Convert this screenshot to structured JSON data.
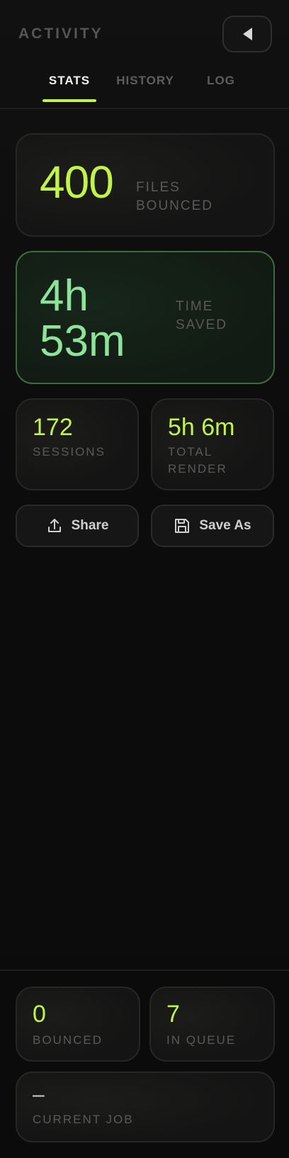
{
  "header": {
    "title": "ACTIVITY",
    "collapse_icon": "triangle-left-icon"
  },
  "tabs": [
    {
      "label": "STATS",
      "active": true
    },
    {
      "label": "HISTORY",
      "active": false
    },
    {
      "label": "LOG",
      "active": false
    }
  ],
  "stats": {
    "files": {
      "value": "400",
      "label": "FILES BOUNCED"
    },
    "time_saved": {
      "value": "4h 53m",
      "label": "TIME SAVED"
    },
    "sessions": {
      "value": "172",
      "label": "SESSIONS"
    },
    "total_render": {
      "value": "5h 6m",
      "label": "TOTAL RENDER"
    }
  },
  "actions": {
    "share_label": "Share",
    "share_icon": "upload-icon",
    "save_as_label": "Save As",
    "save_as_icon": "floppy-disk-icon"
  },
  "footer": {
    "bounced": {
      "value": "0",
      "label": "BOUNCED"
    },
    "in_queue": {
      "value": "7",
      "label": "IN QUEUE"
    },
    "current_job": {
      "value": "–",
      "label": "CURRENT JOB"
    }
  },
  "colors": {
    "accent": "#c2f24b",
    "time_saved_text": "#8de39a",
    "time_saved_border": "#3d6b3d",
    "background": "#0e0e0e",
    "muted_label": "#5a5a5a"
  }
}
